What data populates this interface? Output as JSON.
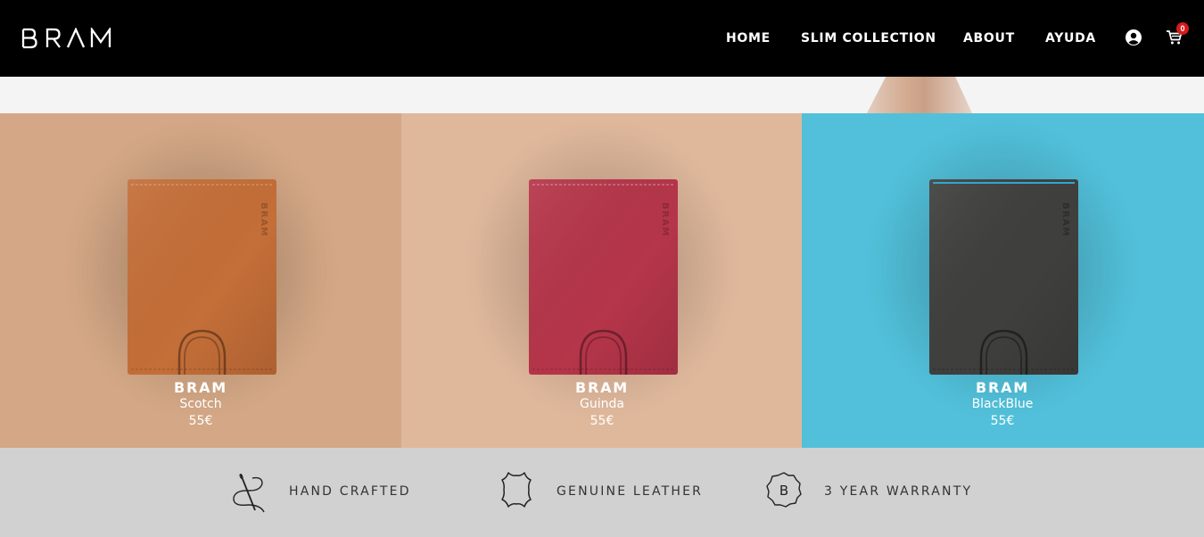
{
  "header": {
    "logo_text": "BRAM",
    "nav": [
      "HOME",
      "SLIM COLLECTION",
      "ABOUT",
      "AYUDA"
    ],
    "account_icon": "user-circle-icon",
    "cart_icon": "shopping-cart-icon",
    "cart_count": "0"
  },
  "products": [
    {
      "brand": "BRAM",
      "model": "Scotch",
      "price": "55€",
      "wallet_color": "#c46e38",
      "background": "#d4a886",
      "stamp": "BRAM"
    },
    {
      "brand": "BRAM",
      "model": "Guinda",
      "price": "55€",
      "wallet_color": "#b53549",
      "background": "#dfb89c",
      "stamp": "BRAM"
    },
    {
      "brand": "BRAM",
      "model": "BlackBlue",
      "price": "55€",
      "wallet_color": "#3f3f3d",
      "background": "#52c0da",
      "stamp": "BRAM"
    }
  ],
  "features": [
    {
      "icon": "needle-thread-icon",
      "label": "HAND CRAFTED"
    },
    {
      "icon": "leather-hide-icon",
      "label": "GENUINE LEATHER"
    },
    {
      "icon": "warranty-badge-icon",
      "label": "3 YEAR WARRANTY",
      "badge_letter": "B"
    }
  ],
  "colors": {
    "header_bg": "#000000",
    "accent_badge": "#d71a1a",
    "feature_band": "#d1d1d1",
    "text_light": "#ffffff"
  }
}
